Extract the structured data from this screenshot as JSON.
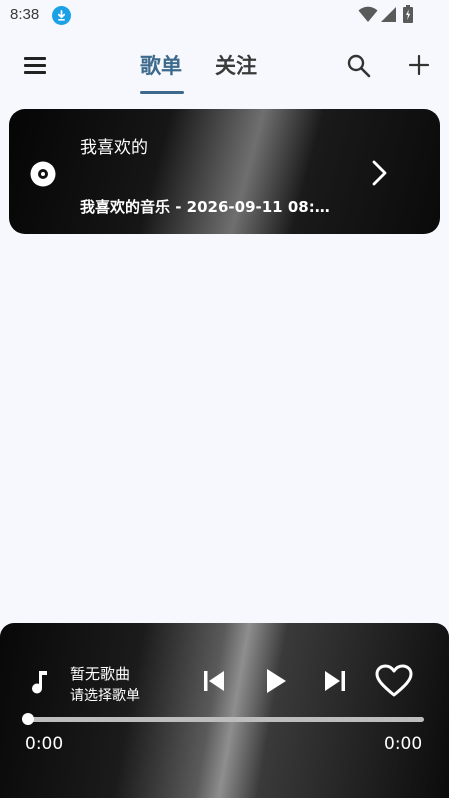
{
  "status_bar": {
    "time": "8:38",
    "icons": [
      "download-badge-icon",
      "wifi-icon",
      "signal-icon",
      "battery-icon"
    ],
    "download_badge_color": "#1aa1e6"
  },
  "top_bar": {
    "tabs": [
      {
        "label": "歌单",
        "active": true
      },
      {
        "label": "关注",
        "active": false
      }
    ],
    "active_color": "#3d6a8c",
    "icons": [
      "menu-icon",
      "search-icon",
      "plus-icon"
    ]
  },
  "playlists": [
    {
      "title": "我喜欢的",
      "subtitle": "我喜欢的音乐 - 2026-09-11 08:…",
      "icon": "disc-icon"
    }
  ],
  "player": {
    "song_title": "暂无歌曲",
    "song_subtitle": "请选择歌单",
    "current_time": "0:00",
    "total_time": "0:00",
    "progress": 0,
    "icons": [
      "music-note-icon",
      "skip-previous-icon",
      "play-icon",
      "skip-next-icon",
      "heart-icon"
    ]
  }
}
